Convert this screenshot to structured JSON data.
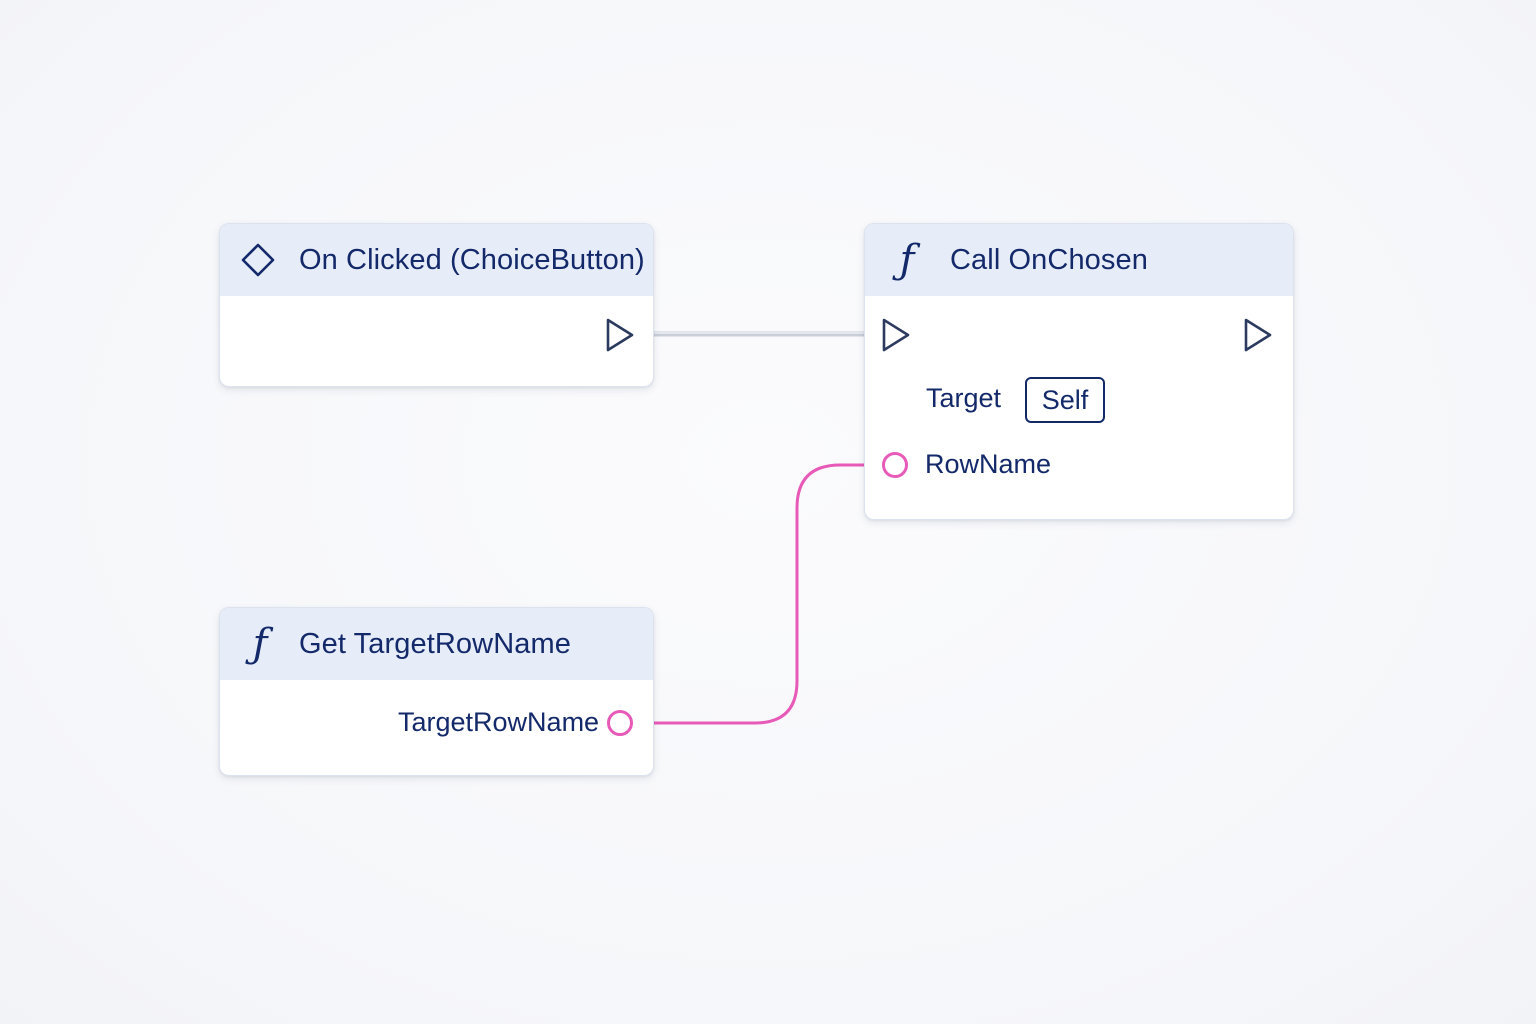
{
  "nodes": {
    "on_clicked": {
      "title": "On Clicked (ChoiceButton)",
      "icon": "event-diamond-icon"
    },
    "call_onchosen": {
      "title": "Call OnChosen",
      "icon": "function-icon",
      "icon_glyph": "ƒ",
      "target_label": "Target",
      "target_value": "Self",
      "rowname_label": "RowName"
    },
    "get_targetrowname": {
      "title": "Get TargetRowName",
      "icon": "function-icon",
      "icon_glyph": "ƒ",
      "output_label": "TargetRowName"
    }
  },
  "colors": {
    "node_header": "#e6ecf8",
    "text": "#13296a",
    "exec_wire": "#c9ced8",
    "data_wire": "#e75ab8",
    "exec_pin": "#2b3a5e"
  }
}
